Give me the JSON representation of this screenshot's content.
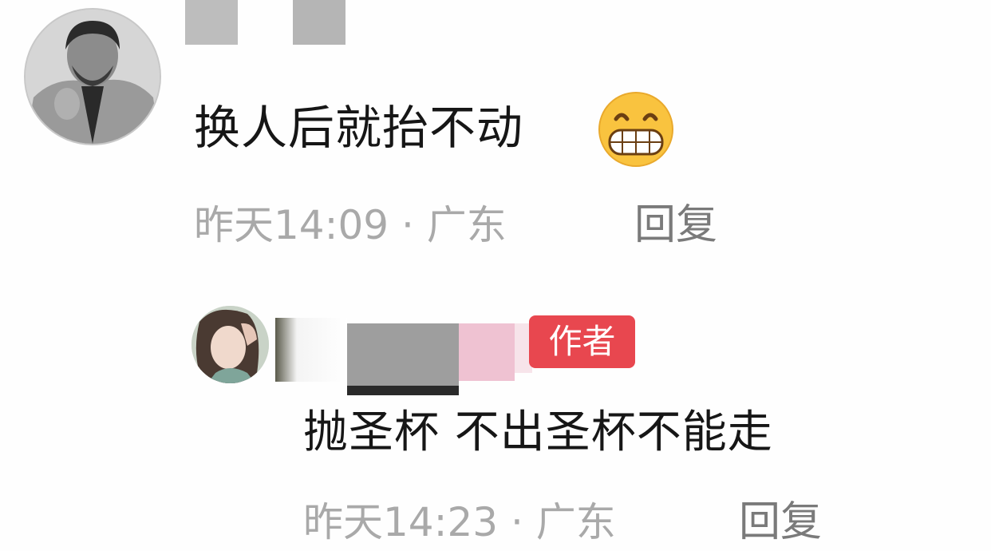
{
  "comments": [
    {
      "text": "换人后就抬不动",
      "meta": "昨天14:09 · 广东",
      "reply_label": "回复",
      "emoji": "grinning-face-icon"
    },
    {
      "badge": "作者",
      "text": "抛圣杯 不出圣杯不能走",
      "meta": "昨天14:23 · 广东",
      "reply_label": "回复"
    }
  ],
  "colors": {
    "author_badge": "#e8474f",
    "meta_text": "#a9a9a9",
    "reply_text": "#7a7a7a",
    "body_text": "#161616"
  }
}
